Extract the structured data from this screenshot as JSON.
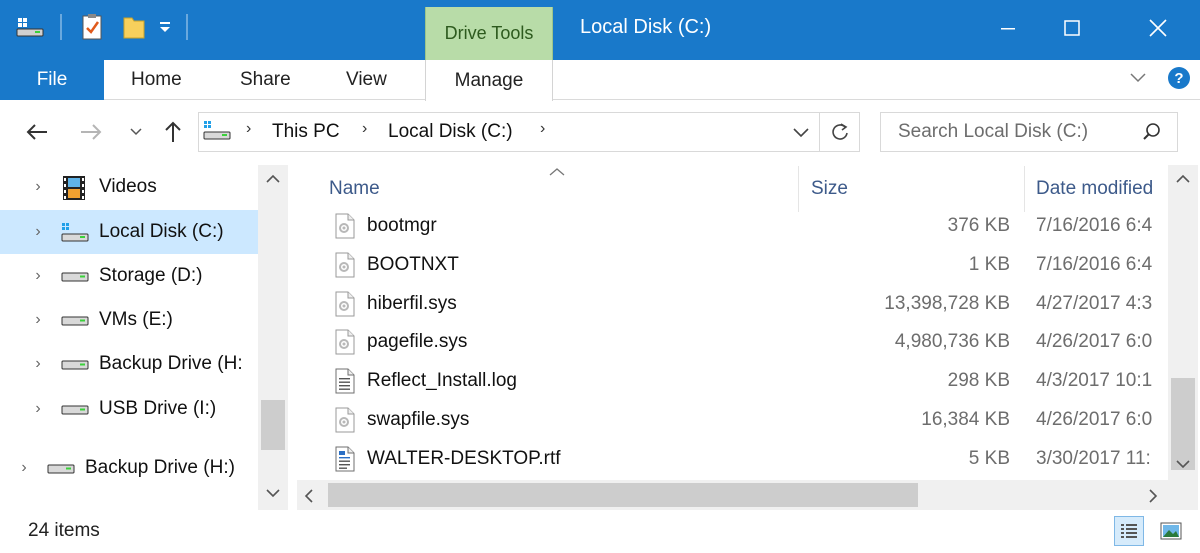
{
  "window": {
    "title": "Local Disk (C:)",
    "contextual_tab": "Drive Tools",
    "accent_color": "#1979ca",
    "contextual_color": "#b8dca8"
  },
  "ribbon": {
    "tabs": [
      {
        "label": "File"
      },
      {
        "label": "Home"
      },
      {
        "label": "Share"
      },
      {
        "label": "View"
      },
      {
        "label": "Manage"
      }
    ]
  },
  "address": {
    "crumbs": [
      "This PC",
      "Local Disk (C:)"
    ]
  },
  "search": {
    "placeholder": "Search Local Disk (C:)"
  },
  "nav": {
    "items": [
      {
        "label": "Videos",
        "icon": "videos-folder-icon"
      },
      {
        "label": "Local Disk (C:)",
        "icon": "system-drive-icon"
      },
      {
        "label": "Storage (D:)",
        "icon": "drive-icon"
      },
      {
        "label": "VMs (E:)",
        "icon": "drive-icon"
      },
      {
        "label": "Backup Drive (H:",
        "icon": "drive-icon"
      },
      {
        "label": "USB Drive (I:)",
        "icon": "drive-icon"
      },
      {
        "label": "Backup Drive (H:)",
        "icon": "drive-icon"
      }
    ]
  },
  "columns": {
    "name": "Name",
    "size": "Size",
    "date": "Date modified"
  },
  "files": [
    {
      "name": "bootmgr",
      "size": "376 KB",
      "date": "7/16/2016 6:4",
      "icon": "system-file-icon"
    },
    {
      "name": "BOOTNXT",
      "size": "1 KB",
      "date": "7/16/2016 6:4",
      "icon": "system-file-icon"
    },
    {
      "name": "hiberfil.sys",
      "size": "13,398,728 KB",
      "date": "4/27/2017 4:3",
      "icon": "system-file-icon"
    },
    {
      "name": "pagefile.sys",
      "size": "4,980,736 KB",
      "date": "4/26/2017 6:0",
      "icon": "system-file-icon"
    },
    {
      "name": "Reflect_Install.log",
      "size": "298 KB",
      "date": "4/3/2017 10:1",
      "icon": "text-file-icon"
    },
    {
      "name": "swapfile.sys",
      "size": "16,384 KB",
      "date": "4/26/2017 6:0",
      "icon": "system-file-icon"
    },
    {
      "name": "WALTER-DESKTOP.rtf",
      "size": "5 KB",
      "date": "3/30/2017 11:",
      "icon": "rtf-file-icon"
    }
  ],
  "status": {
    "item_count": "24 items"
  }
}
